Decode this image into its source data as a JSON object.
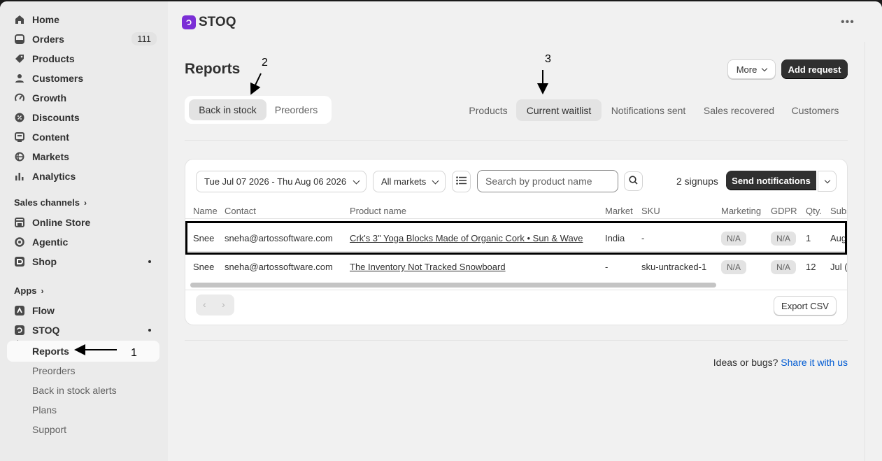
{
  "sidebar": {
    "items": [
      {
        "label": "Home",
        "icon": "home-icon"
      },
      {
        "label": "Orders",
        "icon": "inbox-icon",
        "badge": "111"
      },
      {
        "label": "Products",
        "icon": "tag-icon"
      },
      {
        "label": "Customers",
        "icon": "person-icon"
      },
      {
        "label": "Growth",
        "icon": "gauge-icon"
      },
      {
        "label": "Discounts",
        "icon": "discount-icon"
      },
      {
        "label": "Content",
        "icon": "content-icon"
      },
      {
        "label": "Markets",
        "icon": "globe-icon"
      },
      {
        "label": "Analytics",
        "icon": "bar-chart-icon"
      }
    ],
    "sales_channels_header": "Sales channels",
    "channels": [
      {
        "label": "Online Store",
        "icon": "store-icon"
      },
      {
        "label": "Agentic",
        "icon": "agentic-icon"
      },
      {
        "label": "Shop",
        "icon": "shop-icon"
      }
    ],
    "apps_header": "Apps",
    "apps": [
      {
        "label": "Flow",
        "icon": "flow-icon"
      },
      {
        "label": "STOQ",
        "icon": "stoq-icon"
      }
    ],
    "stoq_sub": [
      "Reports",
      "Preorders",
      "Back in stock alerts",
      "Plans",
      "Support"
    ]
  },
  "app": {
    "name": "STOQ"
  },
  "page": {
    "title": "Reports",
    "more_label": "More",
    "add_request_label": "Add request",
    "segments": [
      "Back in stock",
      "Preorders"
    ],
    "tabs": [
      "Products",
      "Current waitlist",
      "Notifications sent",
      "Sales recovered",
      "Customers"
    ]
  },
  "filters": {
    "date_range": "Tue Jul 07 2026 - Thu Aug 06 2026",
    "market": "All markets",
    "search_placeholder": "Search by product name",
    "signups": "2 signups",
    "send_label": "Send notifications"
  },
  "table": {
    "columns": [
      "Name",
      "Contact",
      "Product name",
      "Market",
      "SKU",
      "Marketing",
      "GDPR",
      "Qty.",
      "Subs"
    ],
    "rows": [
      {
        "name": "Snee",
        "contact": "sneha@artossoftware.com",
        "product": "Crk's 3\" Yoga Blocks Made of Organic Cork • Sun & Wave",
        "market": "India",
        "sku": "-",
        "marketing": "N/A",
        "gdpr": "N/A",
        "qty": "1",
        "subs": "Aug"
      },
      {
        "name": "Snee",
        "contact": "sneha@artossoftware.com",
        "product": "The Inventory Not Tracked Snowboard",
        "market": "-",
        "sku": "sku-untracked-1",
        "marketing": "N/A",
        "gdpr": "N/A",
        "qty": "12",
        "subs": "Jul ("
      }
    ]
  },
  "export_label": "Export CSV",
  "footer": {
    "text": "Ideas or bugs?",
    "link": "Share it with us"
  },
  "annotations": [
    "1",
    "2",
    "3"
  ]
}
